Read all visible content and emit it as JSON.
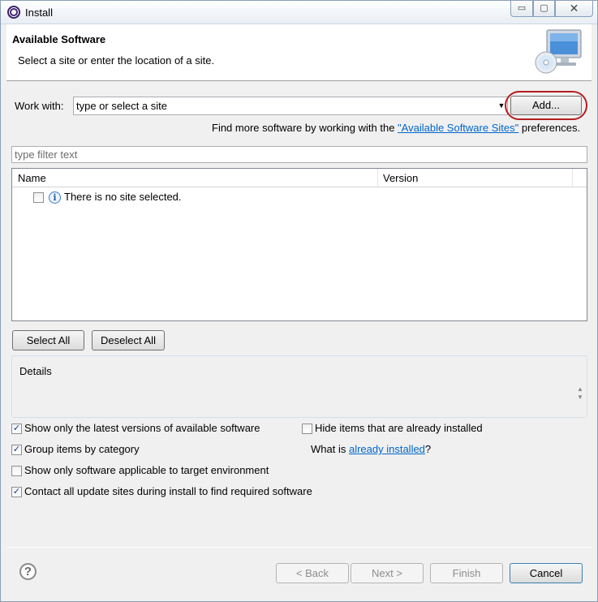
{
  "window": {
    "title": "Install",
    "minimize_glyph": "▭",
    "maximize_glyph": "▢",
    "close_glyph": "✕"
  },
  "header": {
    "title": "Available Software",
    "description": "Select a site or enter the location of a site."
  },
  "work_with": {
    "label": "Work with:",
    "value": "type or select a site",
    "dropdown_glyph": "▼",
    "add_button": "Add..."
  },
  "find_more": {
    "prefix": "Find more software by working with the ",
    "link": "\"Available Software Sites\"",
    "suffix": " preferences."
  },
  "filter": {
    "placeholder": "type filter text"
  },
  "tree": {
    "columns": [
      "Name",
      "Version"
    ],
    "rows": [
      {
        "checked": false,
        "icon": "info-icon",
        "text": "There is no site selected."
      }
    ]
  },
  "selection_buttons": {
    "select_all": "Select All",
    "deselect_all": "Deselect All"
  },
  "details": {
    "title": "Details",
    "scroll_up": "▲",
    "scroll_down": "▼"
  },
  "options": {
    "latest_versions": {
      "label": "Show only the latest versions of available software",
      "checked": true
    },
    "hide_installed": {
      "label": "Hide items that are already installed",
      "checked": false
    },
    "group_by_category": {
      "label": "Group items by category",
      "checked": true
    },
    "what_is_prefix": "What is ",
    "what_is_link": "already installed",
    "what_is_suffix": "?",
    "target_env": {
      "label": "Show only software applicable to target environment",
      "checked": false
    },
    "contact_sites": {
      "label": "Contact all update sites during install to find required software",
      "checked": true
    }
  },
  "footer": {
    "help_glyph": "?",
    "back": "< Back",
    "next": "Next >",
    "finish": "Finish",
    "cancel": "Cancel"
  },
  "colors": {
    "link": "#0066cc",
    "highlight_ring": "#b41e1e"
  }
}
